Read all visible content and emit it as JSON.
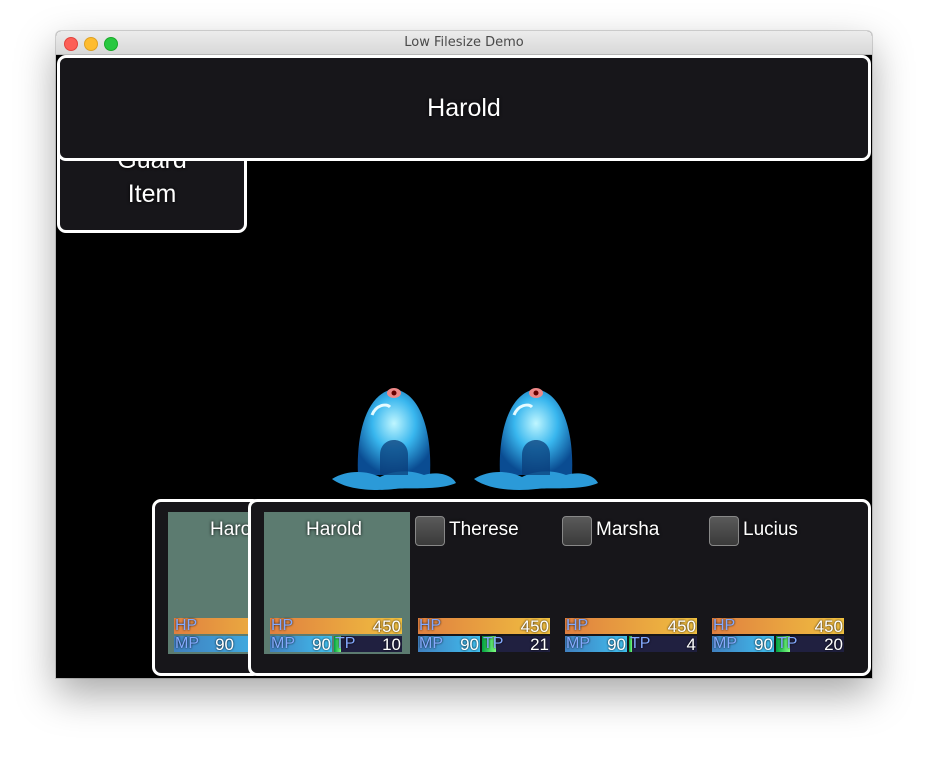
{
  "window": {
    "title": "Low Filesize Demo"
  },
  "help": {
    "actor_name": "Harold"
  },
  "commands": [
    "Guard",
    "Item"
  ],
  "back_status": {
    "name": "Haro"
  },
  "gauge_labels": {
    "hp": "HP",
    "mp": "MP",
    "tp": "TP"
  },
  "actors": [
    {
      "name": "Harold",
      "hp": "450",
      "hp_rate": 1.0,
      "mp": "90",
      "mp_rate": 1.0,
      "tp": "10",
      "tp_rate": 0.1,
      "selected": true
    },
    {
      "name": "Therese",
      "hp": "450",
      "hp_rate": 1.0,
      "mp": "90",
      "mp_rate": 1.0,
      "tp": "21",
      "tp_rate": 0.21,
      "selected": false
    },
    {
      "name": "Marsha",
      "hp": "450",
      "hp_rate": 1.0,
      "mp": "90",
      "mp_rate": 1.0,
      "tp": "4",
      "tp_rate": 0.04,
      "selected": false
    },
    {
      "name": "Lucius",
      "hp": "450",
      "hp_rate": 1.0,
      "mp": "90",
      "mp_rate": 1.0,
      "tp": "20",
      "tp_rate": 0.2,
      "selected": false
    }
  ],
  "enemies": [
    {
      "sprite": "blue-slime"
    },
    {
      "sprite": "blue-slime"
    }
  ]
}
